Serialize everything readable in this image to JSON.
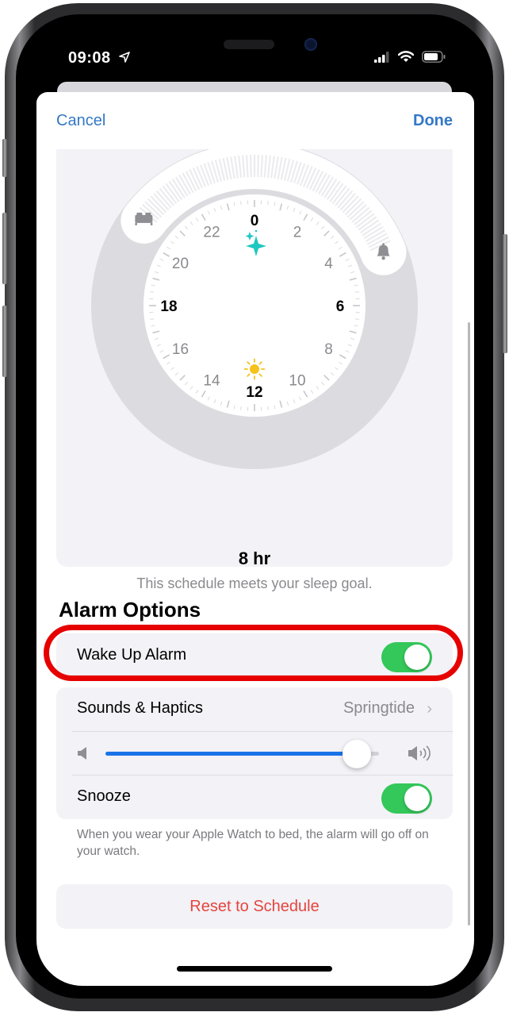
{
  "status_bar": {
    "time": "09:08",
    "location_icon": "location-arrow-icon",
    "signal_icon": "cellular-signal-icon",
    "wifi_icon": "wifi-icon",
    "battery_icon": "battery-icon"
  },
  "nav": {
    "cancel_label": "Cancel",
    "done_label": "Done"
  },
  "clock": {
    "hour_labels": [
      "0",
      "2",
      "4",
      "6",
      "8",
      "10",
      "12",
      "14",
      "16",
      "18",
      "20",
      "22"
    ],
    "bold_hours": [
      "0",
      "6",
      "12",
      "18"
    ],
    "bedtime_icon": "bed-icon",
    "wake_icon": "bell-icon",
    "night_icon": "sparkles-icon",
    "day_icon": "sun-icon",
    "bedtime_hour": 20.5,
    "wake_hour": 4.5,
    "night_icon_color": "#1fc7c1",
    "day_icon_color": "#f5c21b"
  },
  "summary": {
    "duration": "8 hr",
    "message": "This schedule meets your sleep goal."
  },
  "alarm_options": {
    "title": "Alarm Options",
    "wake_up_alarm": {
      "label": "Wake Up Alarm",
      "enabled": true
    },
    "sounds": {
      "label": "Sounds & Haptics",
      "value": "Springtide"
    },
    "volume": {
      "level": 0.92,
      "min_icon": "speaker-low-icon",
      "max_icon": "speaker-high-icon"
    },
    "snooze": {
      "label": "Snooze",
      "enabled": true
    },
    "footnote": "When you wear your Apple Watch to bed, the alarm will go off on your watch."
  },
  "reset_button": {
    "label": "Reset to Schedule"
  },
  "colors": {
    "accent_blue": "#3478c6",
    "toggle_green": "#34c759",
    "destructive_red": "#e5453c",
    "slider_blue": "#1a74e8",
    "highlight_red": "#e60000"
  }
}
